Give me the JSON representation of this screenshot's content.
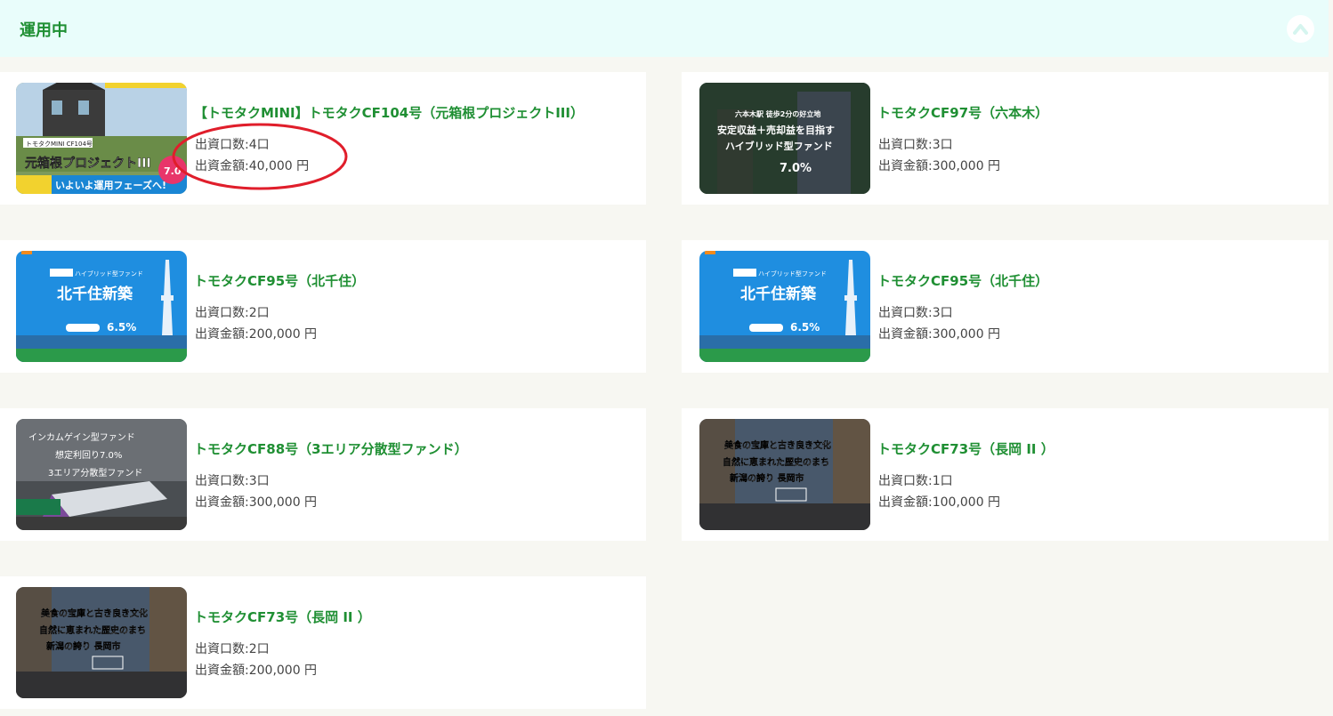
{
  "section": {
    "title": "運用中",
    "collapse_icon": "chevron-up-icon"
  },
  "colors": {
    "header_bg": "#e9fdfb",
    "accent_green": "#1f8f33",
    "annotation_red": "#e01e2b"
  },
  "funds": [
    {
      "title": "【トモタクMINI】トモタクCF104号（元箱根プロジェクトIII）",
      "units": "出資口数:4口",
      "amount": "出資金額:40,000 円",
      "thumb_caption": "元箱根プロジェクトIII",
      "thumb_badge": "トモタクMINI CF104号",
      "thumb_banner": "いよいよ運用フェーズへ!",
      "thumb_rate": "7.0"
    },
    {
      "title": "トモタクCF97号（六本木）",
      "units": "出資口数:3口",
      "amount": "出資金額:300,000 円",
      "thumb_line1": "六本木駅 徒歩2分の好立地",
      "thumb_line2": "安定収益＋売却益を目指す",
      "thumb_line3": "ハイブリッド型ファンド",
      "thumb_rate": "7.0%"
    },
    {
      "title": "トモタクCF95号（北千住）",
      "units": "出資口数:2口",
      "amount": "出資金額:200,000 円",
      "thumb_tag": "ハイブリッド型ファンド",
      "thumb_caption": "北千住新築",
      "thumb_rate": "6.5%"
    },
    {
      "title": "トモタクCF95号（北千住）",
      "units": "出資口数:3口",
      "amount": "出資金額:300,000 円",
      "thumb_tag": "ハイブリッド型ファンド",
      "thumb_caption": "北千住新築",
      "thumb_rate": "6.5%"
    },
    {
      "title": "トモタクCF88号（3エリア分散型ファンド）",
      "units": "出資口数:3口",
      "amount": "出資金額:300,000 円",
      "thumb_line1": "インカムゲイン型ファンド",
      "thumb_line2": "想定利回り7.0%",
      "thumb_line3": "3エリア分散型ファンド"
    },
    {
      "title": "トモタクCF73号（長岡 II ）",
      "units": "出資口数:1口",
      "amount": "出資金額:100,000 円",
      "thumb_line1": "美食の宝庫と古き良き文化",
      "thumb_line2": "自然に恵まれた歴史のまち",
      "thumb_line3": "新潟の誇り 長岡市"
    },
    {
      "title": "トモタクCF73号（長岡 II ）",
      "units": "出資口数:2口",
      "amount": "出資金額:200,000 円",
      "thumb_line1": "美食の宝庫と古き良き文化",
      "thumb_line2": "自然に恵まれた歴史のまち",
      "thumb_line3": "新潟の誇り 長岡市"
    }
  ]
}
